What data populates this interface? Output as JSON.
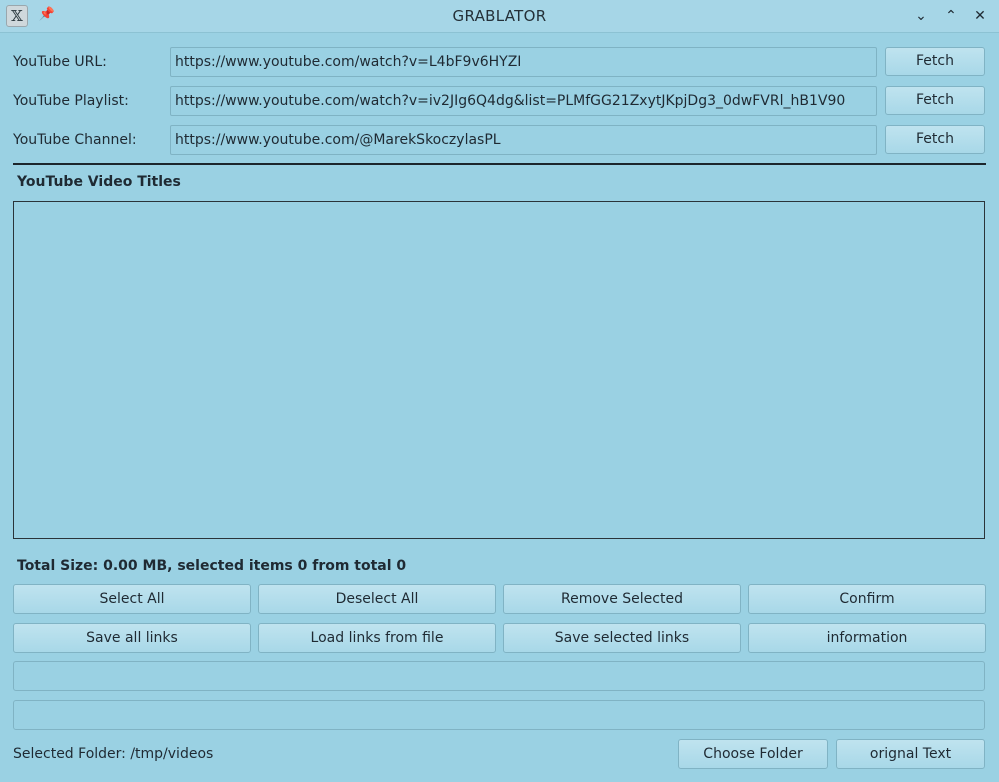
{
  "window": {
    "title": "GRABLATOR",
    "app_icon_glyph": "𝕏",
    "pin_glyph": "📌",
    "minimize_glyph": "⌄",
    "maximize_glyph": "⌃",
    "close_glyph": "✕"
  },
  "inputs": {
    "url": {
      "label": "YouTube URL:",
      "value": "https://www.youtube.com/watch?v=L4bF9v6HYZI",
      "button": "Fetch"
    },
    "playlist": {
      "label": "YouTube Playlist:",
      "value": "https://www.youtube.com/watch?v=iv2JIg6Q4dg&list=PLMfGG21ZxytJKpjDg3_0dwFVRl_hB1V90",
      "button": "Fetch"
    },
    "channel": {
      "label": "YouTube Channel:",
      "value": "https://www.youtube.com/@MarekSkoczylasPL",
      "button": "Fetch"
    }
  },
  "titles_section": {
    "heading": "YouTube Video Titles",
    "items": []
  },
  "status": {
    "total_size": "Total Size: 0.00 MB, selected items 0 from total 0"
  },
  "actions": {
    "select_all": "Select All",
    "deselect_all": "Deselect All",
    "remove_selected": "Remove Selected",
    "confirm": "Confirm",
    "save_all_links": "Save all links",
    "load_links": "Load links from file",
    "save_selected_links": "Save selected links",
    "information": "information"
  },
  "footer": {
    "selected_folder": "Selected Folder: /tmp/videos",
    "choose_folder": "Choose Folder",
    "original_text": "orignal Text"
  },
  "colors": {
    "background": "#9ad1e3",
    "button": "#b3ddec",
    "border": "#80b3c4",
    "separator": "#1c262c"
  }
}
